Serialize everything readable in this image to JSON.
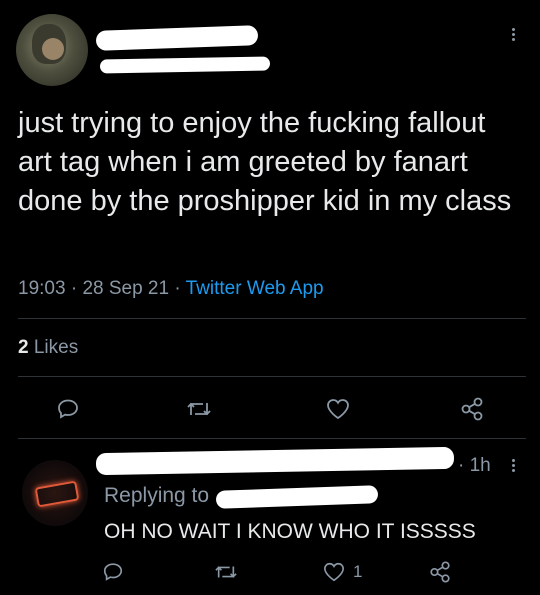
{
  "tweet": {
    "text": "just trying to enjoy the fucking fallout art tag when i am greeted by fanart done by the proshipper kid in my class",
    "time": "19:03",
    "sep1": "·",
    "date": "28 Sep 21",
    "sep2": "·",
    "source": "Twitter Web App",
    "likes_count": "2",
    "likes_label": "Likes"
  },
  "reply": {
    "time_sep": "·",
    "time": "1h",
    "replying_prefix": "Replying to",
    "text": "OH NO WAIT I KNOW WHO IT ISSSSS",
    "like_count": "1"
  },
  "icons": {
    "more": "more-vertical-icon",
    "reply": "reply-icon",
    "retweet": "retweet-icon",
    "like": "heart-icon",
    "share": "share-icon"
  },
  "colors": {
    "background": "#000000",
    "text": "#e7e9ea",
    "muted": "#8b98a5",
    "link": "#1d9bf0",
    "divider": "#2f3336"
  }
}
